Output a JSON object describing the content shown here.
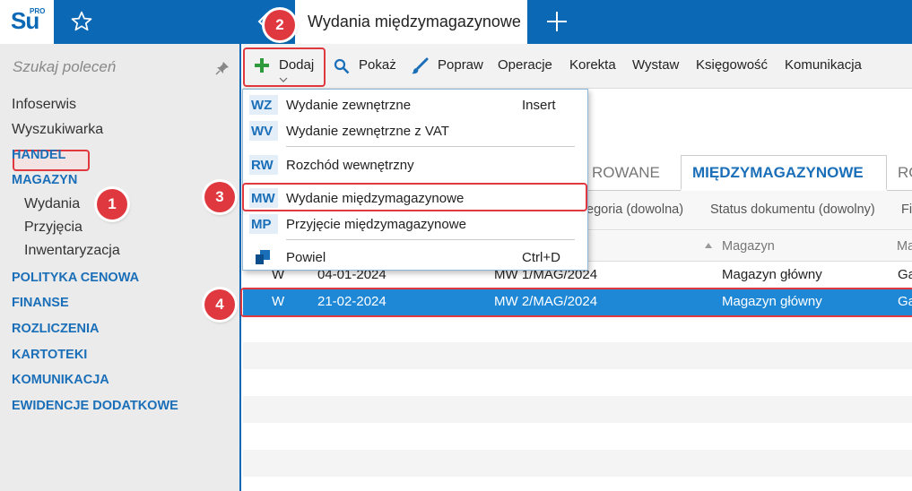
{
  "app": {
    "logo_text": "Su",
    "logo_sup": "PRO",
    "tab_title": "Wydania międzymagazynowe"
  },
  "sidebar": {
    "search_placeholder": "Szukaj poleceń",
    "items": [
      {
        "label": "Infoserwis"
      },
      {
        "label": "Wyszukiwarka"
      },
      {
        "label": "HANDEL"
      },
      {
        "label": "MAGAZYN"
      },
      {
        "label": "Wydania"
      },
      {
        "label": "Przyjęcia"
      },
      {
        "label": "Inwentaryzacja"
      },
      {
        "label": "POLITYKA CENOWA"
      },
      {
        "label": "FINANSE"
      },
      {
        "label": "ROZLICZENIA"
      },
      {
        "label": "KARTOTEKI"
      },
      {
        "label": "KOMUNIKACJA"
      },
      {
        "label": "EWIDENCJE DODATKOWE"
      }
    ]
  },
  "toolbar": {
    "dodaj": "Dodaj",
    "pokaz": "Pokaż",
    "popraw": "Popraw",
    "operacje": "Operacje",
    "korekta": "Korekta",
    "wystaw": "Wystaw",
    "ksiegowosc": "Księgowość",
    "komunikacja": "Komunikacja"
  },
  "dropdown": {
    "items": [
      {
        "code": "WZ",
        "label": "Wydanie zewnętrzne",
        "shortcut": "Insert"
      },
      {
        "code": "WV",
        "label": "Wydanie zewnętrzne z VAT",
        "shortcut": ""
      },
      {
        "code": "RW",
        "label": "Rozchód wewnętrzny",
        "shortcut": ""
      },
      {
        "code": "MW",
        "label": "Wydanie międzymagazynowe",
        "shortcut": ""
      },
      {
        "code": "MP",
        "label": "Przyjęcie międzymagazynowe",
        "shortcut": ""
      },
      {
        "code": "",
        "label": "Powiel",
        "shortcut": "Ctrl+D"
      }
    ]
  },
  "tabs": {
    "prev": "ROWANE",
    "active": "MIĘDZYMAGAZYNOWE",
    "next": "RO"
  },
  "filters": {
    "kategoria": "tegoria (dowolna)",
    "status": "Status dokumentu (dowolny)",
    "more": "Fi"
  },
  "columns": {
    "magazyn": "Magazyn",
    "more": "Ma"
  },
  "rows": [
    {
      "type": "W",
      "date": "04-01-2024",
      "number": "MW 1/MAG/2024",
      "warehouse": "Magazyn główny",
      "extra": "Ga"
    },
    {
      "type": "W",
      "date": "21-02-2024",
      "number": "MW 2/MAG/2024",
      "warehouse": "Magazyn główny",
      "extra": "Ga"
    }
  ],
  "badges": [
    "1",
    "2",
    "3",
    "4"
  ],
  "colors": {
    "brand": "#0a68b4",
    "accent": "#1a6fb8",
    "highlight": "#e0383f",
    "selected_row": "#1e88d6"
  }
}
